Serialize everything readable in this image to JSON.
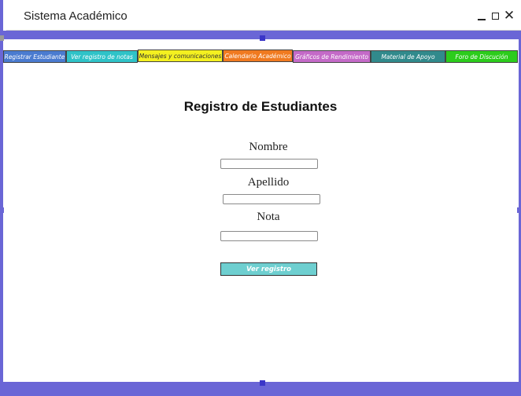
{
  "window": {
    "title": "Sistema Académico",
    "controls": {
      "minimize": "minimize-icon",
      "maximize": "maximize-icon",
      "close": "close-icon"
    }
  },
  "nav": {
    "items": [
      {
        "label": "Registrar Estudiante",
        "bg": "#4a7bd0",
        "fg": "#ffffff"
      },
      {
        "label": "Ver registro de notas",
        "bg": "#2fc3c8",
        "fg": "#ffffff"
      },
      {
        "label": "Mensajes y comunicaciones",
        "bg": "#f4f020",
        "fg": "#333333"
      },
      {
        "label": "Calendario Académico",
        "bg": "#f07a20",
        "fg": "#ffffff"
      },
      {
        "label": "Gráficos de Rendimiento",
        "bg": "#c46ac8",
        "fg": "#ffffff"
      },
      {
        "label": "Material de Apoyo",
        "bg": "#318a8c",
        "fg": "#ffffff"
      },
      {
        "label": "Foro de Discución",
        "bg": "#2ccc1c",
        "fg": "#ffffff"
      }
    ]
  },
  "main": {
    "heading": "Registro de Estudiantes",
    "fields": [
      {
        "label": "Nombre",
        "value": ""
      },
      {
        "label": "Apellido",
        "value": ""
      },
      {
        "label": "Nota",
        "value": ""
      }
    ],
    "submit_label": "Ver registro"
  },
  "colors": {
    "frame": "#6a66d6",
    "submit": "#6ecfd0"
  }
}
